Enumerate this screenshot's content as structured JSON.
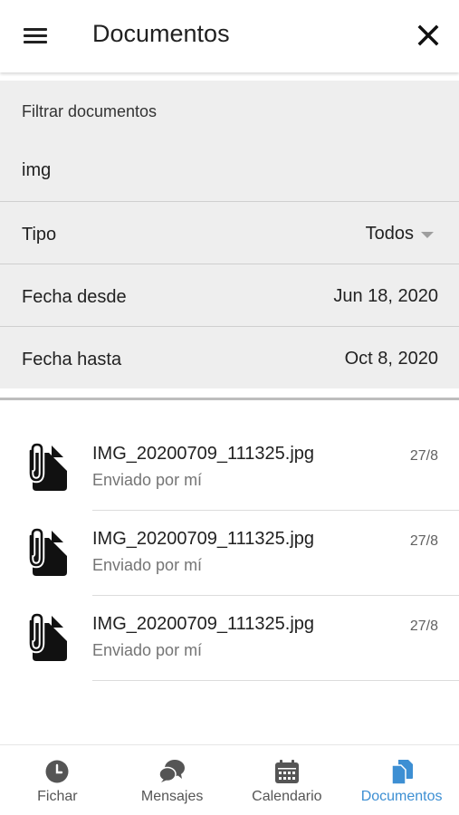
{
  "header": {
    "title": "Documentos",
    "menu_icon": "hamburger-menu-icon",
    "close_icon": "close-icon"
  },
  "filter": {
    "search_label": "Filtrar documentos",
    "search_value": "img",
    "type_label": "Tipo",
    "type_value": "Todos",
    "date_from_label": "Fecha desde",
    "date_from_value": "Jun 18, 2020",
    "date_to_label": "Fecha hasta",
    "date_to_value": "Oct 8, 2020"
  },
  "documents": [
    {
      "name": "IMG_20200709_111325.jpg",
      "sender": "Enviado por mí",
      "date": "27/8",
      "icon": "attachment-file-icon"
    },
    {
      "name": "IMG_20200709_111325.jpg",
      "sender": "Enviado por mí",
      "date": "27/8",
      "icon": "attachment-file-icon"
    },
    {
      "name": "IMG_20200709_111325.jpg",
      "sender": "Enviado por mí",
      "date": "27/8",
      "icon": "attachment-file-icon"
    }
  ],
  "bottom_nav": {
    "items": [
      {
        "label": "Fichar",
        "icon": "clock-icon",
        "active": false
      },
      {
        "label": "Mensajes",
        "icon": "chat-bubbles-icon",
        "active": false
      },
      {
        "label": "Calendario",
        "icon": "calendar-icon",
        "active": false
      },
      {
        "label": "Documentos",
        "icon": "documents-icon",
        "active": true
      }
    ]
  },
  "colors": {
    "accent": "#3d8fd3",
    "filter_background": "#eeeeee",
    "inactive_nav": "#555555"
  }
}
